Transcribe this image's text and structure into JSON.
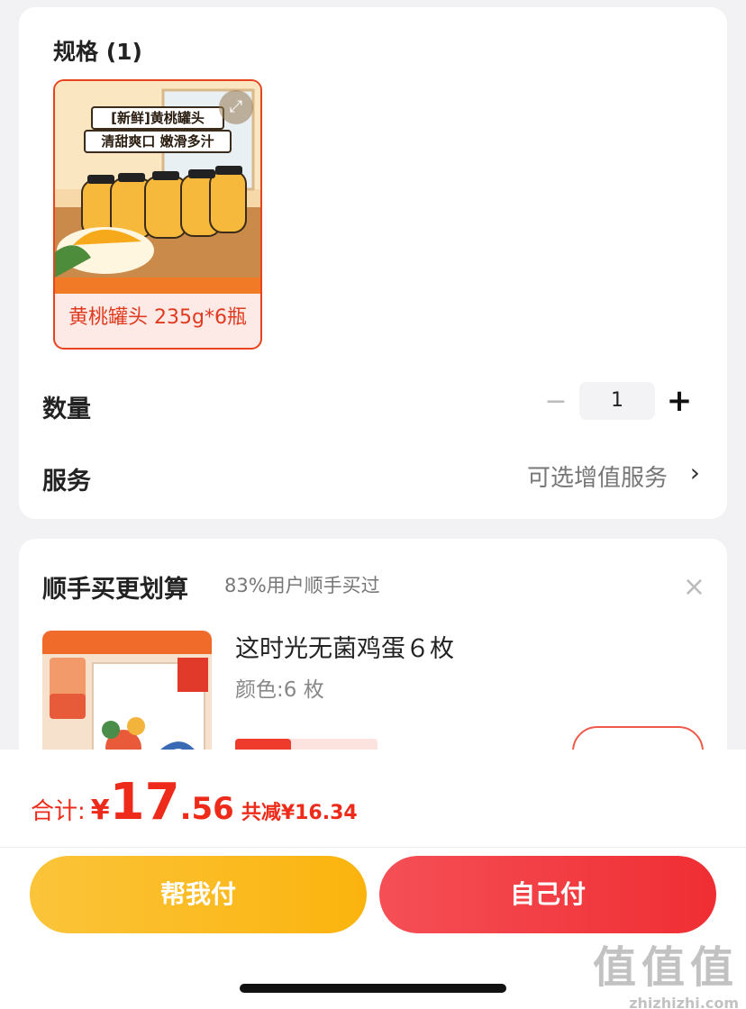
{
  "spec": {
    "title": "规格 (1)",
    "option": {
      "banner_line1": "[新鲜]黄桃罐头",
      "banner_line2": "清甜爽口 嫩滑多汁",
      "label": "黄桃罐头 235g*6瓶"
    },
    "quantity": {
      "label": "数量",
      "minus": "−",
      "value": "1",
      "plus": "+"
    },
    "service": {
      "label": "服务",
      "value": "可选增值服务",
      "chevron": "›"
    }
  },
  "addon": {
    "title": "顺手买更划算",
    "subtitle": "83%用户顺手买过",
    "close": "×",
    "product": {
      "name": "这时光无菌鸡蛋６枚",
      "variant": "颜色:6 枚"
    }
  },
  "footer": {
    "total_label": "合计:",
    "currency": "¥",
    "total_int": "17",
    "total_dec": ".56",
    "discount": "共减¥16.34",
    "help_pay": "帮我付",
    "self_pay": "自己付"
  },
  "watermark": {
    "main": "值值值",
    "url": "zhizhizhi.com"
  },
  "colors": {
    "accent": "#ee2b1a",
    "help_pay": "#fbbd25",
    "self_pay": "#f23a3f"
  },
  "icons": [
    "expand-icon",
    "minus-icon",
    "plus-icon",
    "chevron-right-icon",
    "close-icon"
  ]
}
